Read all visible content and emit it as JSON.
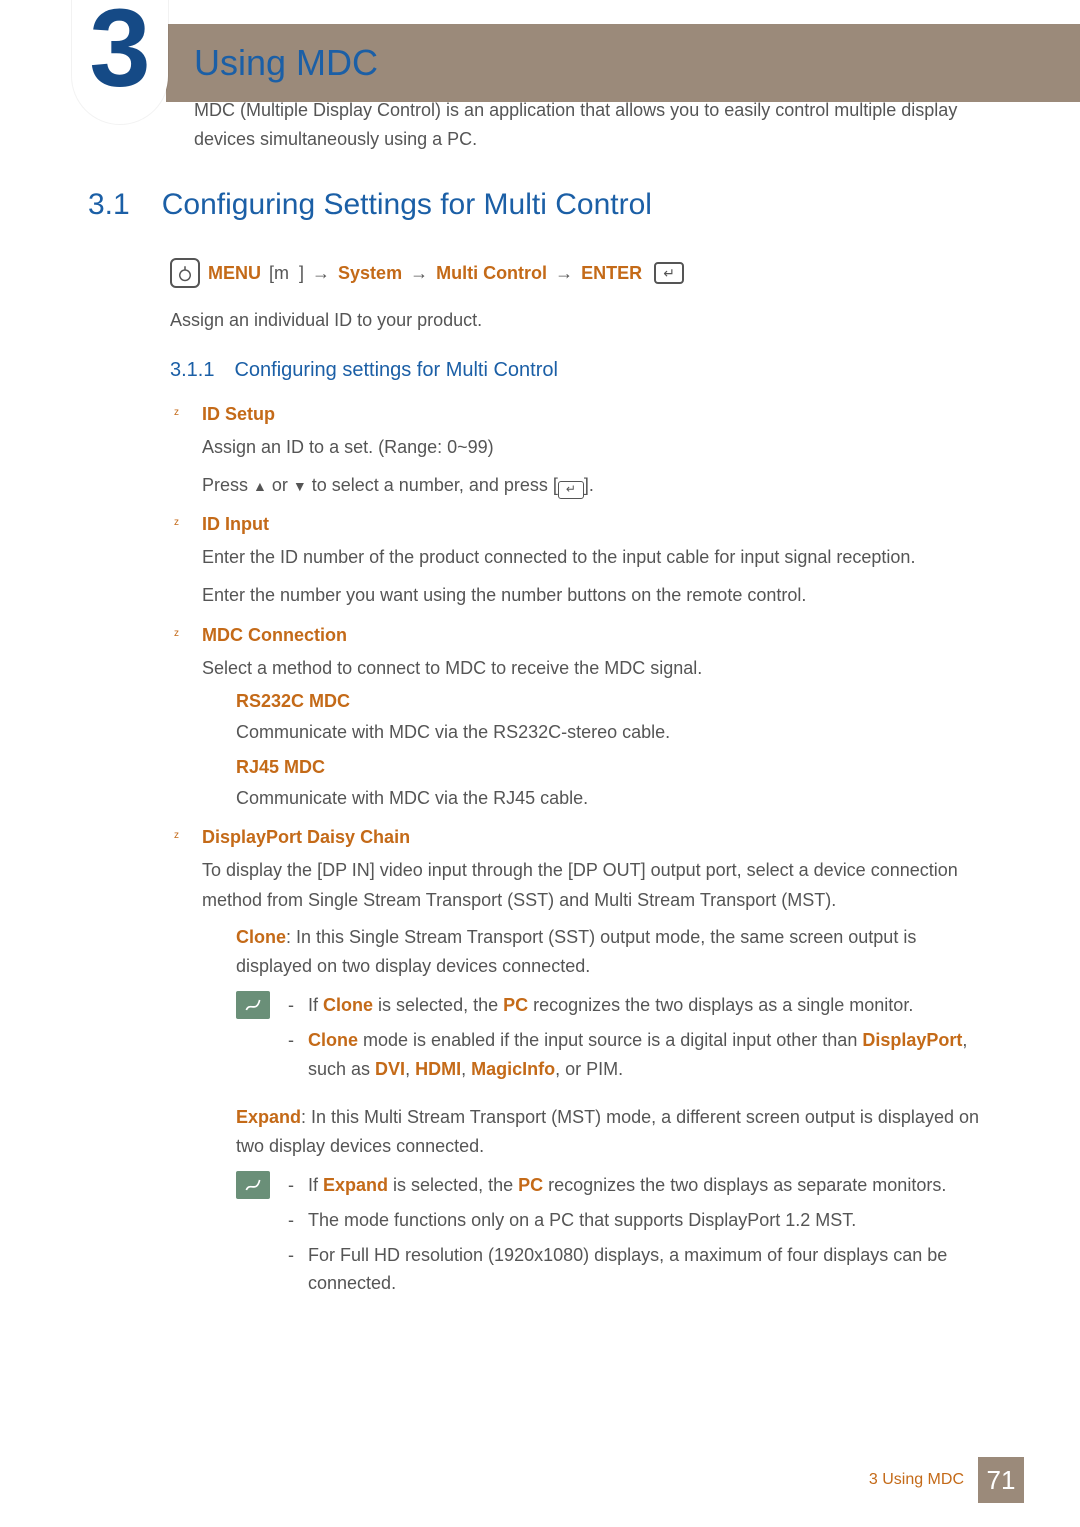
{
  "header": {
    "chapter_number": "3",
    "title": "Using MDC",
    "intro": "MDC (Multiple Display Control) is an application that allows you to easily control multiple display devices simultaneously using a PC."
  },
  "section": {
    "number": "3.1",
    "title": "Configuring Settings for Multi Control",
    "nav": {
      "menu": "MENU",
      "menu_icon_glyph": "m",
      "system": "System",
      "multi": "Multi Control",
      "enter": "ENTER"
    },
    "assign": "Assign an individual ID to your product.",
    "sub": {
      "number": "3.1.1",
      "title": "Configuring settings for Multi Control"
    },
    "items": {
      "id_setup": {
        "title": "ID Setup",
        "line1": "Assign an ID to a set. (Range: 0~99)",
        "line2_pre": "Press ",
        "line2_mid": " or ",
        "line2_post": " to select a number, and press [",
        "line2_end": "]."
      },
      "id_input": {
        "title": "ID Input",
        "line1": "Enter the ID number of the product connected to the input cable for input signal reception.",
        "line2": "Enter the number you want using the number buttons on the remote control."
      },
      "mdc_conn": {
        "title": "MDC Connection",
        "line1": "Select a method to connect to MDC to receive the MDC signal.",
        "rs232c": {
          "title": "RS232C MDC",
          "text": "Communicate with MDC via the RS232C-stereo cable."
        },
        "rj45": {
          "title": "RJ45 MDC",
          "text": "Communicate with MDC via the RJ45 cable."
        }
      },
      "daisy": {
        "title": "DisplayPort Daisy Chain",
        "line1": "To display the [DP IN] video input through the [DP OUT] output port, select a device connection method from Single Stream Transport (SST) and Multi Stream Transport (MST).",
        "clone": {
          "label": "Clone",
          "text": ": In this Single Stream Transport (SST) output mode, the same screen output is displayed on two display devices connected.",
          "note1_pre": "If ",
          "note1_mid": " is selected, the ",
          "note1_pc": "PC",
          "note1_post": " recognizes the two displays as a single monitor.",
          "note2_pre": "",
          "note2_mid": " mode is enabled if the input source is a digital input other than ",
          "note2_dp": "DisplayPort",
          "note2_such": ", such as ",
          "note2_dvi": "DVI",
          "note2_c1": ", ",
          "note2_hdmi": "HDMI",
          "note2_c2": ", ",
          "note2_mi": "MagicInfo",
          "note2_end": ", or PIM."
        },
        "expand": {
          "label": "Expand",
          "text": ": In this Multi Stream Transport (MST) mode, a different screen output is displayed on two display devices connected.",
          "note1_pre": "If ",
          "note1_mid": " is selected, the ",
          "note1_pc": "PC",
          "note1_post": " recognizes the two displays as separate monitors.",
          "note2": "The mode functions only on a PC that supports DisplayPort 1.2 MST.",
          "note3": "For Full HD resolution (1920x1080) displays, a maximum of four displays can be connected."
        }
      }
    }
  },
  "footer": {
    "text": "3 Using MDC",
    "page": "71"
  }
}
